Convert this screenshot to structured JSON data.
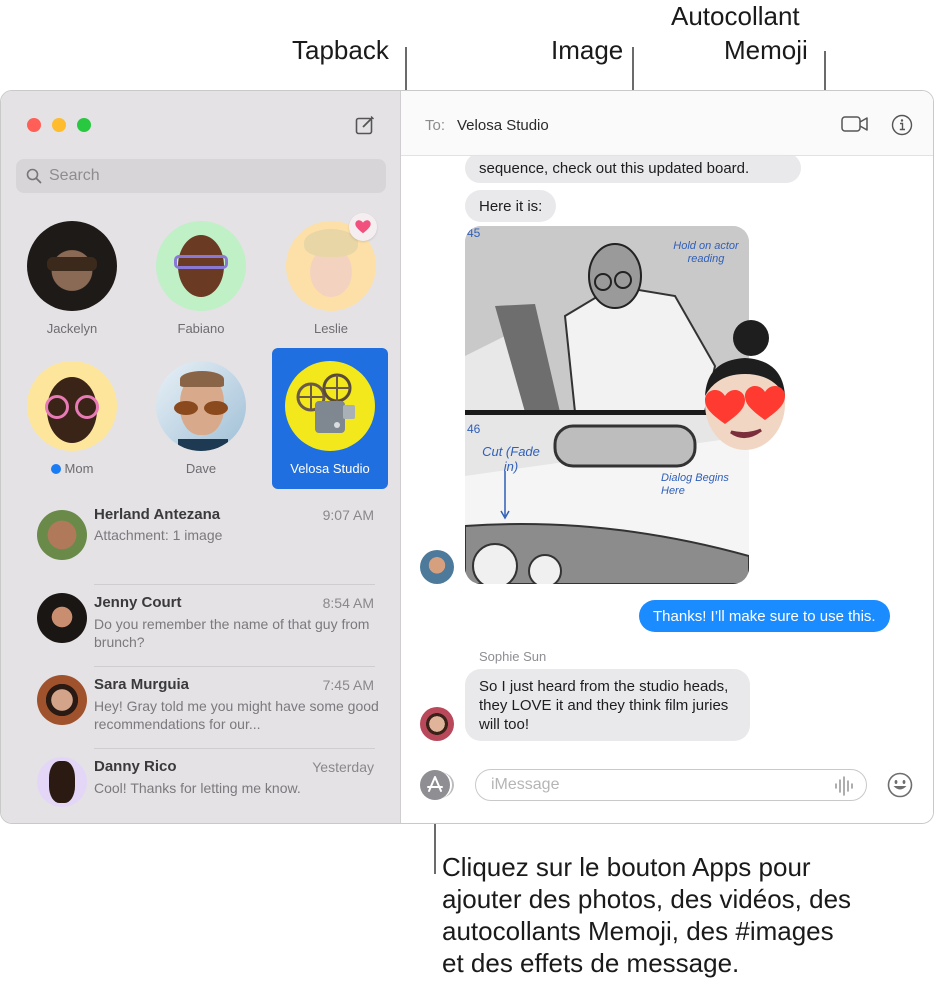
{
  "callouts": {
    "tapback": "Tapback",
    "image": "Image",
    "memoji_line1": "Autocollant",
    "memoji_line2": "Memoji",
    "apps_lines": [
      "Cliquez sur le bouton Apps pour",
      "ajouter des photos, des vidéos, des",
      "autocollants Memoji, des #images",
      "et des effets de message."
    ]
  },
  "window": {
    "traffic_lights": {
      "close": "#ff5f57",
      "minimize": "#febc2e",
      "maximize": "#28c840"
    }
  },
  "sidebar": {
    "search_placeholder": "Search",
    "pinned": [
      {
        "name": "Jackelyn",
        "bg": "#2b2b2b"
      },
      {
        "name": "Fabiano",
        "bg": "#bff0c6"
      },
      {
        "name": "Leslie",
        "bg": "#fde0a8",
        "tapback": "heart"
      },
      {
        "name": "Mom",
        "bg": "#fde69c",
        "unread": true
      },
      {
        "name": "Dave",
        "bg": "#c9dcea"
      },
      {
        "name": "Velosa Studio",
        "bg": "#f2e81c",
        "selected": true
      }
    ],
    "conversations": [
      {
        "name": "Herland Antezana",
        "time": "9:07 AM",
        "preview": "Attachment: 1 image"
      },
      {
        "name": "Jenny Court",
        "time": "8:54 AM",
        "preview": "Do you remember the name of that guy from brunch?"
      },
      {
        "name": "Sara Murguia",
        "time": "7:45 AM",
        "preview": "Hey! Gray told me you might have some good recommendations for our..."
      },
      {
        "name": "Danny Rico",
        "time": "Yesterday",
        "preview": "Cool! Thanks for letting me know."
      }
    ]
  },
  "chat": {
    "to_label": "To:",
    "recipient": "Velosa Studio",
    "messages": {
      "m1": "sequence, check out this updated board.",
      "m2": "Here it is:",
      "image_notes": {
        "n45": "45",
        "hold": "Hold on actor reading",
        "n46": "46",
        "cut": "Cut (Fade in)",
        "dialog": "Dialog Begins Here"
      },
      "outgoing": "Thanks! I’ll make sure to use this.",
      "sender": "Sophie Sun",
      "incoming_last": "So I just heard from the studio heads, they LOVE it and they think film juries will too!"
    },
    "input_placeholder": "iMessage",
    "accent": "#1a8cff"
  }
}
